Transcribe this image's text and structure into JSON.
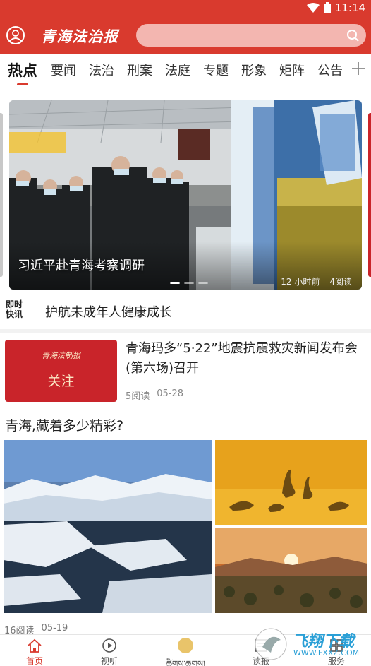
{
  "status": {
    "time": "11:14"
  },
  "header": {
    "logo": "青海法治报",
    "search_placeholder": ""
  },
  "tabs": [
    {
      "label": "热点",
      "active": true
    },
    {
      "label": "要闻"
    },
    {
      "label": "法治"
    },
    {
      "label": "刑案"
    },
    {
      "label": "法庭"
    },
    {
      "label": "专题"
    },
    {
      "label": "形象"
    },
    {
      "label": "矩阵"
    },
    {
      "label": "公告"
    }
  ],
  "banner": {
    "title": "习近平赴青海考察调研",
    "time": "12 小时前",
    "reads": "4阅读"
  },
  "flash": {
    "logo_line1": "即时",
    "logo_line2": "快讯",
    "text": "护航未成年人健康成长"
  },
  "news": {
    "thumb_logo": "青海法制报",
    "thumb_word": "关注",
    "title": "青海玛多“5·22”地震抗震救灾新闻发布会(第六场)召开",
    "reads": "5阅读",
    "date": "05-28"
  },
  "gallery": {
    "title": "青海,藏着多少精彩?",
    "reads": "16阅读",
    "date": "05-19"
  },
  "bottom_nav": [
    {
      "label": "首页",
      "icon": "home-icon",
      "active": true
    },
    {
      "label": "视听",
      "icon": "play-icon"
    },
    {
      "label": "ཚིགས་ཆགས།",
      "icon": "tibetan-logo-icon"
    },
    {
      "label": "读报",
      "icon": "newspaper-icon"
    },
    {
      "label": "服务",
      "icon": "service-icon"
    }
  ],
  "watermark": {
    "text": "飞翔下载",
    "url": "WWW.FXXZ.COM"
  },
  "colors": {
    "brand": "#d93a2e",
    "search_bg": "#f3b6b0"
  }
}
